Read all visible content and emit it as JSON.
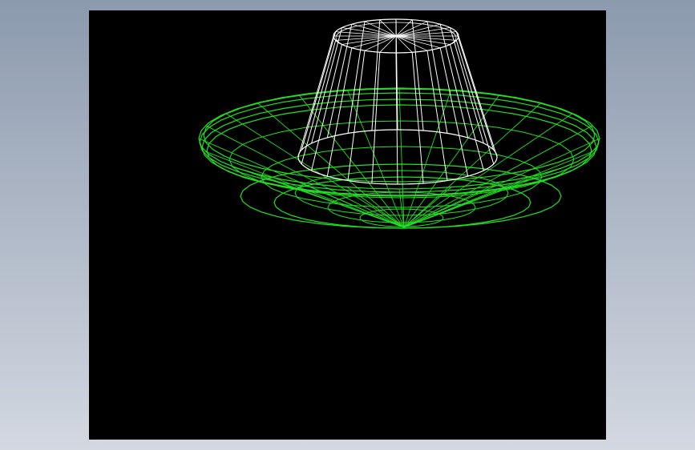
{
  "viewport": {
    "background_color": "#000000",
    "app_background_top": "#8c9aae",
    "app_background_bottom": "#d3d8e1"
  },
  "models": [
    {
      "name": "cup",
      "render_mode": "wireframe",
      "color": "#ffffff"
    },
    {
      "name": "bowl",
      "render_mode": "wireframe",
      "color": "#22e022"
    }
  ]
}
